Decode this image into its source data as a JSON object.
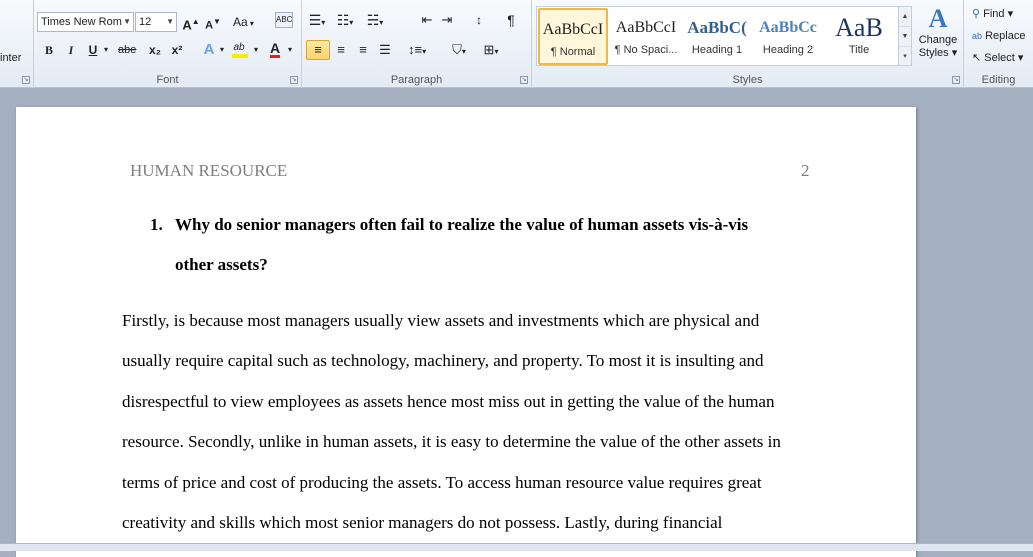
{
  "clipboard": {
    "format_painter_label": "inter"
  },
  "font": {
    "group_label": "Font",
    "font_name": "Times New Rom",
    "font_size": "12",
    "grow_label": "A",
    "shrink_label": "A",
    "change_case_label": "Aa",
    "clear_format_label": "ABC",
    "bold_label": "B",
    "italic_label": "I",
    "underline_label": "U",
    "strikethrough_label": "abe",
    "subscript_label": "x₂",
    "superscript_label": "x²",
    "text_effects_label": "A",
    "highlight_label": "ab",
    "font_color_label": "A",
    "font_color": "#e02020",
    "highlight_color": "#f2f000"
  },
  "paragraph": {
    "group_label": "Paragraph",
    "show_marks_label": "¶"
  },
  "styles": {
    "group_label": "Styles",
    "items": [
      {
        "sample": "AaBbCcI",
        "name": "¶ Normal"
      },
      {
        "sample": "AaBbCcI",
        "name": "¶ No Spaci..."
      },
      {
        "sample": "AaBbC(",
        "name": "Heading 1"
      },
      {
        "sample": "AaBbCc",
        "name": "Heading 2"
      },
      {
        "sample": "AaB",
        "name": "Title"
      }
    ],
    "change_styles_label_1": "Change",
    "change_styles_label_2": "Styles ▾"
  },
  "editing": {
    "group_label": "Editing",
    "find_label": "Find ▾",
    "replace_label": "Replace",
    "select_label": "Select ▾"
  },
  "document": {
    "running_head": "HUMAN RESOURCE",
    "page_number": "2",
    "question_number": "1.",
    "question_line1": "Why do senior managers often fail to realize the value of human assets vis-à-vis",
    "question_line2": "other assets?",
    "paragraph_lines": [
      "Firstly, is because most managers usually view assets and investments which are physical and",
      "usually require capital such as technology, machinery, and property. To most it is insulting and",
      "disrespectful to view employees as assets hence most miss out in getting the value of the human",
      "resource. Secondly, unlike in human assets, it is easy to determine the value of the other assets in",
      "terms of price and cost of producing the assets. To access human resource value requires great",
      "creativity and skills which most senior managers do not possess. Lastly, during financial"
    ]
  },
  "colors": {
    "ribbon_bg": "#e4ebf5",
    "workspace_bg": "#a5b0c0",
    "selected_style_border": "#f0b74a"
  }
}
